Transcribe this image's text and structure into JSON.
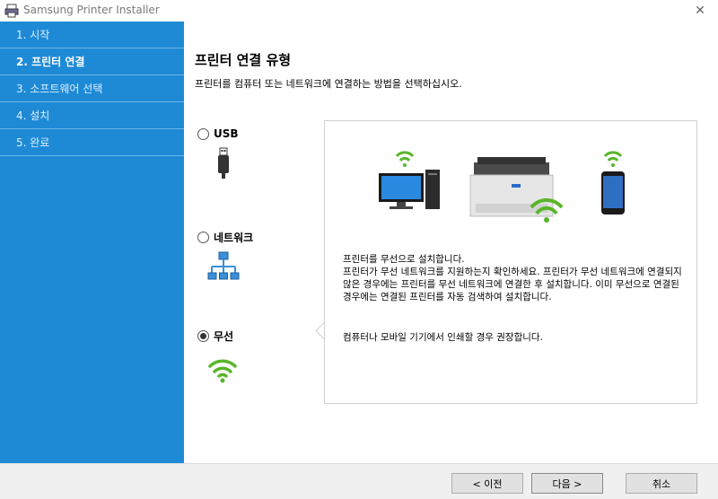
{
  "window": {
    "title": "Samsung Printer Installer",
    "close_glyph": "✕"
  },
  "sidebar": {
    "steps": [
      {
        "label": "1. 시작"
      },
      {
        "label": "2. 프린터 연결"
      },
      {
        "label": "3. 소프트웨어 선택"
      },
      {
        "label": "4. 설치"
      },
      {
        "label": "5. 완료"
      }
    ]
  },
  "main": {
    "heading": "프린터 연결 유형",
    "subtext": "프린터를 컴퓨터 또는 네트워크에 연결하는 방법을 선택하십시오.",
    "options": [
      {
        "label": "USB",
        "icon": "usb-icon",
        "selected": false
      },
      {
        "label": "네트워크",
        "icon": "network-icon",
        "selected": false
      },
      {
        "label": "무선",
        "icon": "wifi-icon",
        "selected": true
      }
    ],
    "panel": {
      "line1": "프린터를 무선으로 설치합니다.",
      "line2": "프린터가 무선 네트워크를 지원하는지 확인하세요. 프린터가 무선 네트워크에 연결되지 않은 경우에는 프린터를 무선 네트워크에 연결한 후 설치합니다. 이미 무선으로 연결된 경우에는 연결된 프린터를 자동 검색하여 설치합니다.",
      "recommendation": "컴퓨터나 모바일 기기에서 인쇄할 경우 권장합니다."
    }
  },
  "footer": {
    "back_label": "< 이전",
    "next_label": "다음 >",
    "cancel_label": "취소"
  },
  "colors": {
    "sidebar": "#1e8ad6",
    "wifi_green": "#5ab52a"
  }
}
